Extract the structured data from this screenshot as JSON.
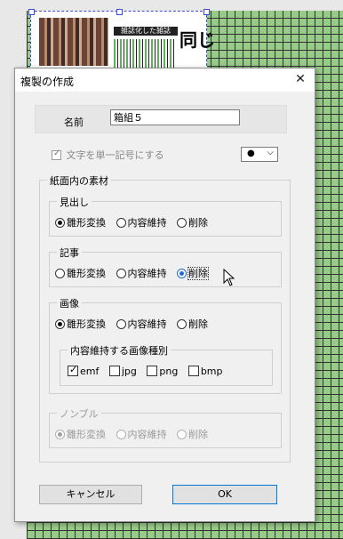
{
  "background": {
    "headline_text": "雑誌化した雑誌",
    "big_text": "同じ"
  },
  "dialog": {
    "title": "複製の作成",
    "name_label": "名前",
    "name_value": "箱組５",
    "single_symbol_label": "文字を単一記号にする",
    "single_symbol_checked": true,
    "single_symbol_disabled": true,
    "symbol_dropdown_value": "●",
    "materials_group_label": "紙面内の素材",
    "headline": {
      "label": "見出し",
      "options": [
        "雛形変換",
        "内容維持",
        "削除"
      ],
      "selected": 0
    },
    "article": {
      "label": "記事",
      "options": [
        "雛形変換",
        "内容維持",
        "削除"
      ],
      "selected": 2
    },
    "image": {
      "label": "画像",
      "options": [
        "雛形変換",
        "内容維持",
        "削除"
      ],
      "selected": 0,
      "types_label": "内容維持する画像種別",
      "types": [
        {
          "label": "emf",
          "checked": true
        },
        {
          "label": "jpg",
          "checked": false
        },
        {
          "label": "png",
          "checked": false
        },
        {
          "label": "bmp",
          "checked": false
        }
      ]
    },
    "nombre": {
      "label": "ノンブル",
      "options": [
        "雛形変換",
        "内容維持",
        "削除"
      ],
      "selected": 0,
      "disabled": true
    },
    "cancel_label": "キャンセル",
    "ok_label": "OK",
    "close_glyph": "✕"
  },
  "colors": {
    "accent": "#0078d7",
    "selected_radio": "#1e6bd6",
    "stripe_green": "#8fc87e"
  }
}
